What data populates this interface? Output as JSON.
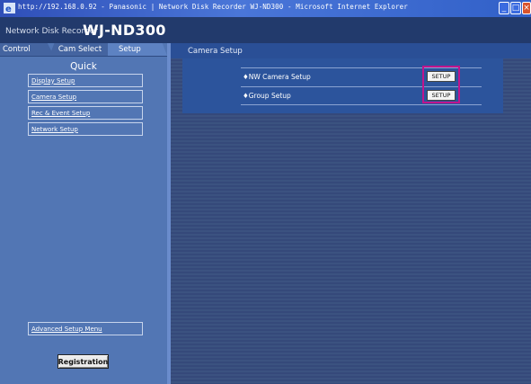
{
  "window": {
    "title": "http://192.168.0.92 - Panasonic | Network Disk Recorder WJ-ND300 - Microsoft Internet Explorer",
    "minimize_glyph": "_",
    "maximize_glyph": "□",
    "close_glyph": "×",
    "icons": {
      "app": "ie-icon",
      "minimize": "minimize-icon",
      "maximize": "maximize-icon",
      "close": "close-icon"
    }
  },
  "header": {
    "prefix": "Network Disk Recorder",
    "model": "WJ-ND300"
  },
  "tabs": [
    {
      "label": "Control",
      "active": false
    },
    {
      "label": "Cam Select",
      "active": false
    },
    {
      "label": "Setup",
      "active": true
    }
  ],
  "sidebar": {
    "title": "Quick",
    "items": [
      {
        "label": "Display Setup"
      },
      {
        "label": "Camera Setup"
      },
      {
        "label": "Rec & Event Setup"
      },
      {
        "label": "Network Setup"
      }
    ],
    "advanced_label": "Advanced Setup Menu",
    "registration_label": "Registration"
  },
  "main": {
    "heading": "Camera Setup",
    "rows": [
      {
        "label": "♦NW Camera Setup",
        "button": "SETUP"
      },
      {
        "label": "♦Group Setup",
        "button": "SETUP"
      }
    ]
  },
  "colors": {
    "title_bar": "#3160c8",
    "header_bg": "#223a6c",
    "sidebar_bg": "#5276b4",
    "main_bg": "#3b5280",
    "setup_box_bg": "#2c549c",
    "highlight": "#c0148c"
  }
}
